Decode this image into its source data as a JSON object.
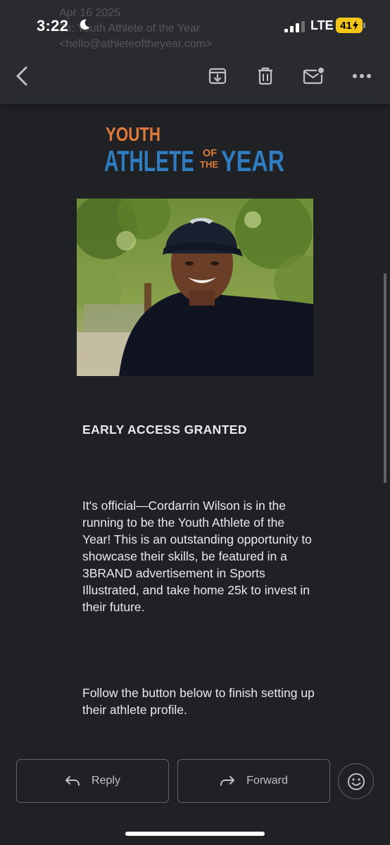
{
  "status_bar": {
    "time": "3:22",
    "network": "LTE",
    "battery": "41"
  },
  "faded_header": {
    "line1": "Apr 16 2025",
    "line2": "To: Youth Athlete of the Year",
    "line3": "<hello@athleteoftheyear.com>"
  },
  "toolbar": {
    "icons": [
      "back-arrow-icon",
      "archive-icon",
      "trash-icon",
      "mark-unread-icon",
      "more-options-icon"
    ]
  },
  "email": {
    "logo": {
      "line1": "YOUTH",
      "line2_a": "ATHLETE",
      "line2_of": "OF",
      "line2_the": "THE",
      "line2_b": "YEAR",
      "orange": "#e07b39",
      "blue": "#2f7dc0"
    },
    "heading": "EARLY ACCESS GRANTED",
    "paragraph1": "It's official—Cordarrin Wilson is in the running to be the Youth Athlete of the Year! This is an outstanding opportunity to showcase their skills, be featured in a 3BRAND advertisement in Sports Illustrated, and take home 25k to invest in their future.",
    "paragraph2": "Follow the button below to finish setting up their athlete profile."
  },
  "actions": {
    "reply_label": "Reply",
    "forward_label": "Forward"
  },
  "colors": {
    "background": "#202124",
    "bar": "#2a2b2f",
    "battery": "#f5c518",
    "text": "#e8eaed"
  }
}
